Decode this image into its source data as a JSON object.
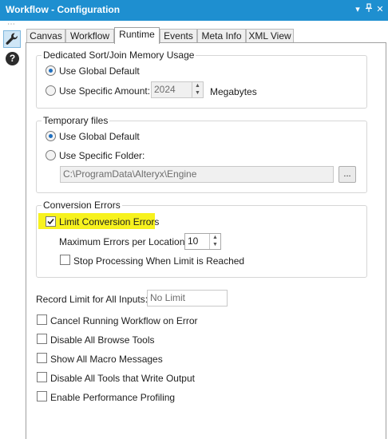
{
  "window": {
    "title": "Workflow - Configuration",
    "controls": {
      "dropdown": "▾",
      "pin": "⊥",
      "close": "✕"
    }
  },
  "leftbar": {
    "dots": "⋯",
    "help_symbol": "?"
  },
  "tabs": [
    {
      "label": "Canvas"
    },
    {
      "label": "Workflow"
    },
    {
      "label": "Runtime",
      "active": true
    },
    {
      "label": "Events"
    },
    {
      "label": "Meta Info"
    },
    {
      "label": "XML View"
    }
  ],
  "memory": {
    "legend": "Dedicated Sort/Join Memory Usage",
    "use_global_default": "Use Global Default",
    "use_specific_amount": "Use Specific Amount:",
    "amount_value": "2024",
    "units": "Megabytes",
    "selected": "use_global_default"
  },
  "temp_files": {
    "legend": "Temporary files",
    "use_global_default": "Use Global Default",
    "use_specific_folder": "Use Specific Folder:",
    "folder_value": "C:\\ProgramData\\Alteryx\\Engine",
    "browse_label": "...",
    "selected": "use_global_default"
  },
  "conversion": {
    "legend": "Conversion Errors",
    "limit_label": "Limit Conversion Errors",
    "limit_checked": true,
    "max_errors_label": "Maximum Errors per Location:",
    "max_errors_value": "10",
    "stop_label": "Stop Processing When Limit is Reached",
    "stop_checked": false,
    "highlight_color": "#f7f21e"
  },
  "record_limit": {
    "label": "Record Limit for All Inputs:",
    "placeholder": "No Limit"
  },
  "options": [
    {
      "label": "Cancel Running Workflow on Error",
      "checked": false
    },
    {
      "label": "Disable All Browse Tools",
      "checked": false
    },
    {
      "label": "Show All Macro Messages",
      "checked": false
    },
    {
      "label": "Disable All Tools that Write Output",
      "checked": false
    },
    {
      "label": "Enable Performance Profiling",
      "checked": false
    }
  ],
  "colors": {
    "titlebar": "#1e8fd0",
    "radio_selected": "#1e6fc0",
    "tool_active_bg": "#cfe6f6"
  },
  "icons": {
    "wrench": "wrench-icon",
    "help": "help-icon",
    "check": "check-icon"
  }
}
